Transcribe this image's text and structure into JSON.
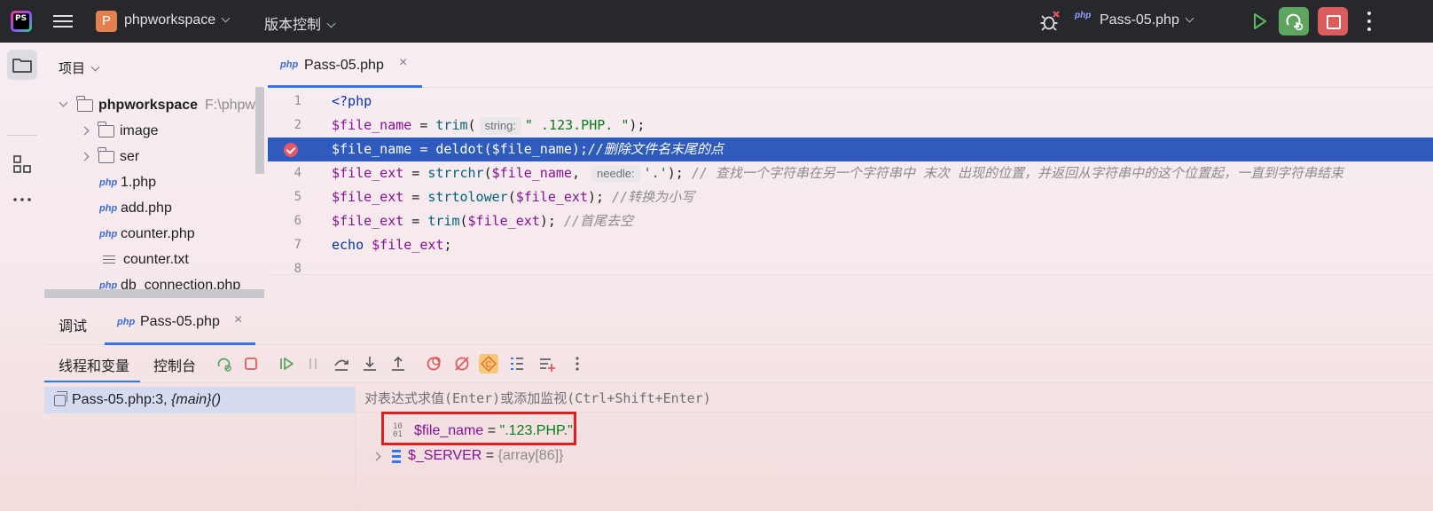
{
  "titlebar": {
    "app_logo_text": "PS",
    "project_badge": "P",
    "project_name": "phpworkspace",
    "vcs_label": "版本控制",
    "run_config": "Pass-05.php",
    "run_config_icon": "php"
  },
  "project_panel": {
    "title": "项目",
    "items": [
      {
        "label": "phpworkspace",
        "hint": "F:\\phpw",
        "type": "folder",
        "expanded": true
      },
      {
        "label": "image",
        "type": "folder"
      },
      {
        "label": "ser",
        "type": "folder"
      },
      {
        "label": "1.php",
        "type": "php"
      },
      {
        "label": "add.php",
        "type": "php"
      },
      {
        "label": "counter.php",
        "type": "php"
      },
      {
        "label": "counter.txt",
        "type": "txt"
      },
      {
        "label": "db_connection.php",
        "type": "php"
      }
    ],
    "php_icon_text": "php"
  },
  "editor": {
    "tab_label": "Pass-05.php",
    "tab_icon": "php",
    "close_glyph": "×",
    "line_numbers": [
      "1",
      "2",
      "3",
      "4",
      "5",
      "6",
      "7",
      "8"
    ],
    "code": {
      "l1": "<?php",
      "l2_var": "$file_name",
      "l2_op": " = ",
      "l2_fn": "trim",
      "l2_p1": "(",
      "l2_hint": "string:",
      "l2_str": "\" .123.PHP. \"",
      "l2_end": ");",
      "l3_code": "$file_name = deldot($file_name);",
      "l3_comment": "//删除文件名末尾的点",
      "l4_var": "$file_ext",
      "l4_op": " = ",
      "l4_fn": "strrchr",
      "l4_p1": "(",
      "l4_var2": "$file_name",
      "l4_comma": ", ",
      "l4_hint": "needle:",
      "l4_str": "'.'",
      "l4_end": "); ",
      "l4_comment": "// 查找一个字符串在另一个字符串中 末次 出现的位置，并返回从字符串中的这个位置起，一直到字符串结束",
      "l5_var": "$file_ext",
      "l5_op": " = ",
      "l5_fn": "strtolower",
      "l5_p1": "(",
      "l5_var2": "$file_ext",
      "l5_end": "); ",
      "l5_comment": "//转换为小写",
      "l6_var": "$file_ext",
      "l6_op": " = ",
      "l6_fn": "trim",
      "l6_p1": "(",
      "l6_var2": "$file_ext",
      "l6_end": "); ",
      "l6_comment": "//首尾去空",
      "l7_kw": "echo",
      "l7_sp": " ",
      "l7_var": "$file_ext",
      "l7_end": ";"
    }
  },
  "debug": {
    "title": "调试",
    "tab_label": "Pass-05.php",
    "tab_icon": "php",
    "close_glyph": "×",
    "subtab_threads": "线程和变量",
    "subtab_console": "控制台",
    "frame_file": "Pass-05.php:3, ",
    "frame_fn": "{main}()",
    "eval_placeholder": "对表达式求值(Enter)或添加监视(Ctrl+Shift+Enter)",
    "variables": [
      {
        "name": "$file_name",
        "eq": " = ",
        "value": "\".123.PHP.\"",
        "kind": "string",
        "icon": "primitive-icon"
      },
      {
        "name": "$_SERVER",
        "eq": " = ",
        "value": "{array[86]}",
        "kind": "array",
        "icon": "array-icon"
      }
    ],
    "primitive_icon_text": "10\n01"
  },
  "colors": {
    "accent": "#3574f0",
    "titlebar_bg": "#27282c",
    "debug_green": "#5fa560",
    "stop_red": "#db5c5c",
    "highlight_line": "#2e5bbd",
    "annotation_box": "#e02020"
  }
}
